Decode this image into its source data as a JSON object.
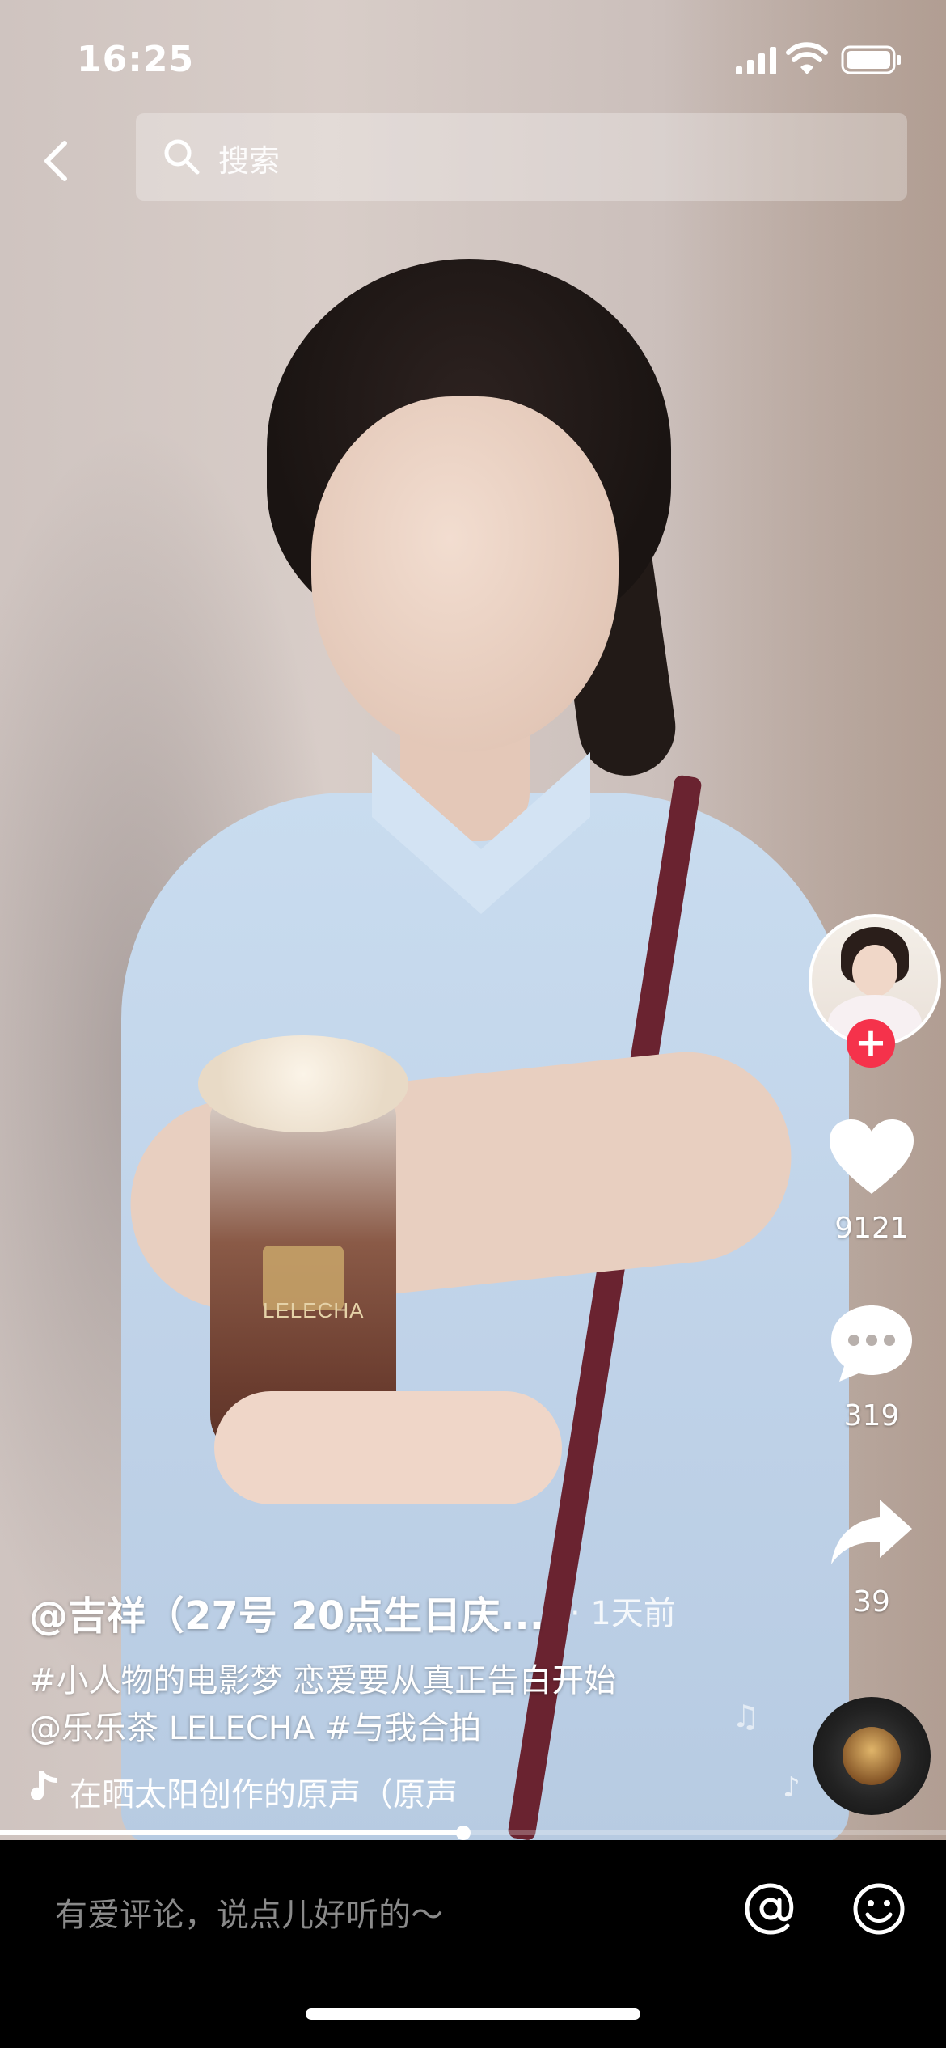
{
  "status_bar": {
    "time": "16:25"
  },
  "search": {
    "placeholder": "搜索"
  },
  "video": {
    "cup_brand": "LELECHA",
    "progress": 0.49
  },
  "creator": {
    "name": "@吉祥（27号 20点生日庆...",
    "posted_ago": "· 1天前",
    "follow_label": "+"
  },
  "caption": {
    "line1": "#小人物的电影梦 恋爱要从真正告白开始",
    "line2": "@乐乐茶 LELECHA #与我合拍"
  },
  "music": {
    "title": "在晒太阳创作的原声（原声"
  },
  "actions": {
    "likes": "9121",
    "comments": "319",
    "shares": "39"
  },
  "comment_bar": {
    "placeholder": "有爱评论，说点儿好听的～"
  },
  "colors": {
    "follow_red": "#f5324b",
    "background": "#000000"
  },
  "icons": [
    "back-icon",
    "search-icon",
    "heart-icon",
    "comment-icon",
    "share-icon",
    "music-note-icon",
    "at-icon",
    "emoji-icon"
  ]
}
